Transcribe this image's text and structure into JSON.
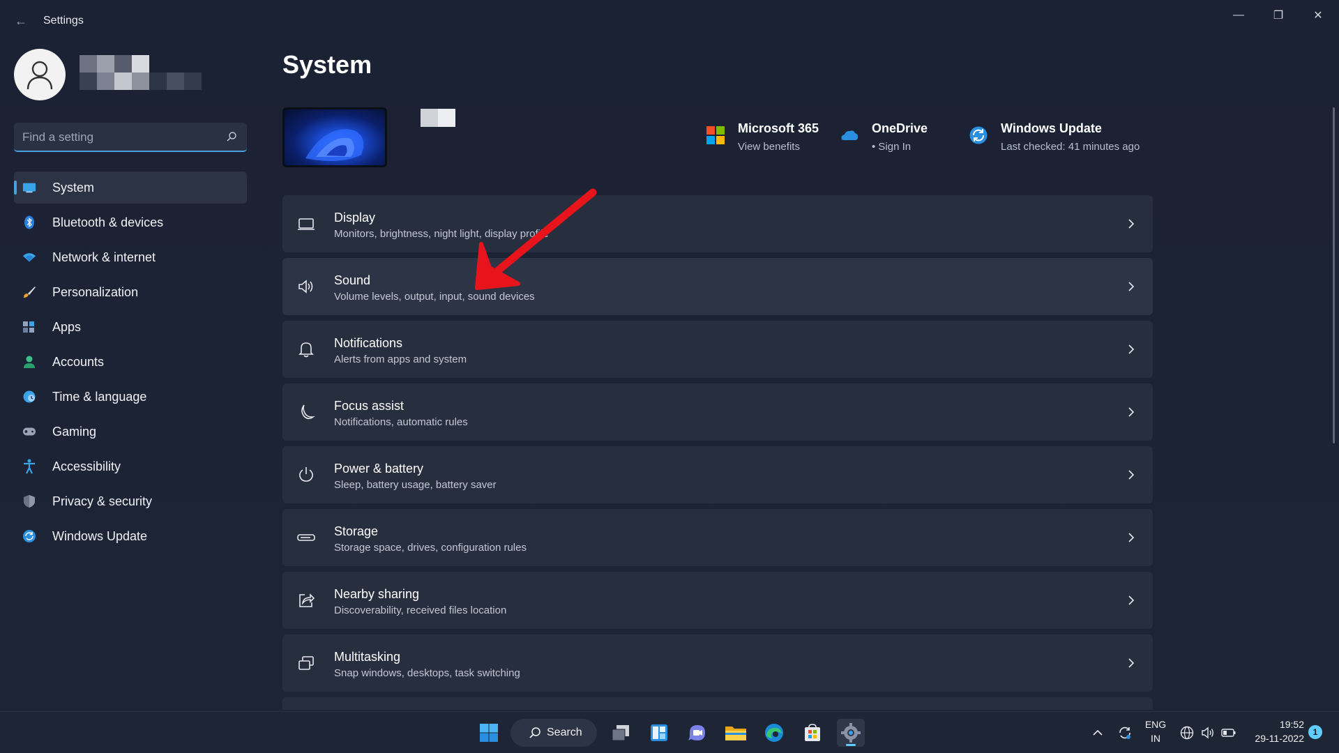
{
  "app": {
    "title": "Settings"
  },
  "window_controls": {
    "minimize": "—",
    "restore": "❐",
    "close": "✕"
  },
  "search": {
    "placeholder": "Find a setting"
  },
  "sidebar": {
    "items": [
      {
        "label": "System",
        "icon": "system-icon",
        "active": true
      },
      {
        "label": "Bluetooth & devices",
        "icon": "bluetooth-icon"
      },
      {
        "label": "Network & internet",
        "icon": "wifi-icon"
      },
      {
        "label": "Personalization",
        "icon": "brush-icon"
      },
      {
        "label": "Apps",
        "icon": "apps-icon"
      },
      {
        "label": "Accounts",
        "icon": "person-icon"
      },
      {
        "label": "Time & language",
        "icon": "clock-globe-icon"
      },
      {
        "label": "Gaming",
        "icon": "gamepad-icon"
      },
      {
        "label": "Accessibility",
        "icon": "accessibility-icon"
      },
      {
        "label": "Privacy & security",
        "icon": "shield-icon"
      },
      {
        "label": "Windows Update",
        "icon": "update-icon"
      }
    ]
  },
  "main": {
    "title": "System",
    "quick_links": [
      {
        "title": "Microsoft 365",
        "subtitle": "View benefits",
        "icon": "microsoft-logo-icon"
      },
      {
        "title": "OneDrive",
        "subtitle": "• Sign In",
        "icon": "onedrive-cloud-icon"
      },
      {
        "title": "Windows Update",
        "subtitle": "Last checked: 41 minutes ago",
        "icon": "update-icon"
      }
    ],
    "cards": [
      {
        "title": "Display",
        "subtitle": "Monitors, brightness, night light, display profile",
        "icon": "laptop-icon"
      },
      {
        "title": "Sound",
        "subtitle": "Volume levels, output, input, sound devices",
        "icon": "speaker-icon"
      },
      {
        "title": "Notifications",
        "subtitle": "Alerts from apps and system",
        "icon": "bell-icon"
      },
      {
        "title": "Focus assist",
        "subtitle": "Notifications, automatic rules",
        "icon": "moon-icon"
      },
      {
        "title": "Power & battery",
        "subtitle": "Sleep, battery usage, battery saver",
        "icon": "power-icon"
      },
      {
        "title": "Storage",
        "subtitle": "Storage space, drives, configuration rules",
        "icon": "storage-icon"
      },
      {
        "title": "Nearby sharing",
        "subtitle": "Discoverability, received files location",
        "icon": "share-icon"
      },
      {
        "title": "Multitasking",
        "subtitle": "Snap windows, desktops, task switching",
        "icon": "multitask-icon"
      }
    ]
  },
  "taskbar": {
    "search_label": "Search",
    "language": {
      "line1": "ENG",
      "line2": "IN"
    },
    "clock": {
      "time": "19:52",
      "date": "29-11-2022"
    },
    "notification_count": "1"
  },
  "colors": {
    "accent": "#4ca0e0",
    "annotation_arrow": "#e8141b",
    "background": "#1b2233",
    "card": "#272e3e"
  }
}
